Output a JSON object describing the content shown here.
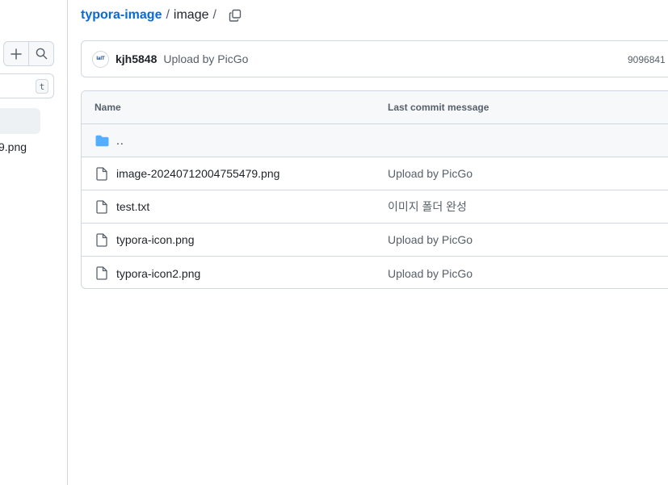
{
  "left_panel": {
    "shortcut_key": "t",
    "tree_item_label": "9.png"
  },
  "breadcrumb": {
    "repo": "typora-image",
    "folder": "image",
    "separator": "/"
  },
  "commit": {
    "avatar_text": "IaIT",
    "author": "kjh5848",
    "message": "Upload by PicGo",
    "sha": "9096841 ·"
  },
  "table": {
    "headers": {
      "name": "Name",
      "message": "Last commit message"
    },
    "parent_label": "..",
    "rows": [
      {
        "name": "image-20240712004755479.png",
        "message": "Upload by PicGo"
      },
      {
        "name": "test.txt",
        "message": "이미지 폴더 완성"
      },
      {
        "name": "typora-icon.png",
        "message": "Upload by PicGo"
      },
      {
        "name": "typora-icon2.png",
        "message": "Upload by PicGo"
      }
    ]
  },
  "colors": {
    "link": "#0969da",
    "folder": "#54aeff",
    "border": "#d0d7de",
    "muted": "#57606a"
  },
  "icons": [
    "plus-icon",
    "search-icon",
    "copy-icon",
    "folder-icon",
    "file-icon"
  ]
}
